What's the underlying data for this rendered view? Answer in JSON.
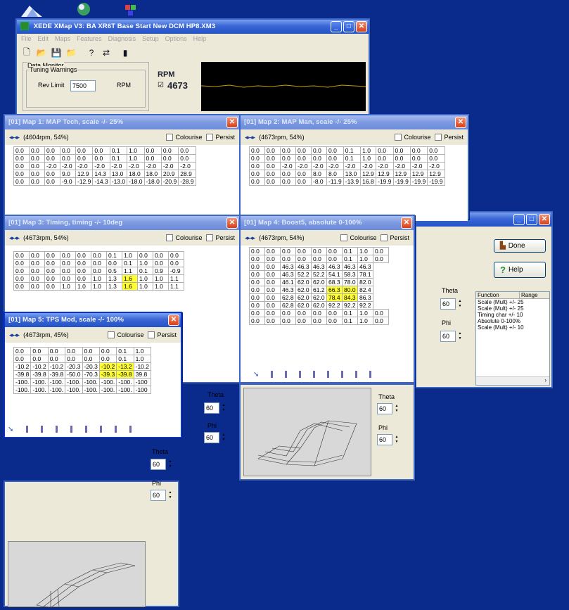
{
  "colors": {
    "desktop": "#0a2a8c",
    "highlight": "#ffff33"
  },
  "main": {
    "title": "XEDE XMap V3: BA XR6T Base Start New DCM HP8.XM3",
    "menu": [
      "File",
      "Edit",
      "Maps",
      "Features",
      "Diagnosis",
      "Setup",
      "Options",
      "Help"
    ],
    "monitor_group": "Data Monitor",
    "tuning_group": "Tuning Warnings",
    "rev_limit_label": "Rev Limit",
    "rev_limit_value": "7500",
    "rev_limit_unit": "RPM",
    "rpm_label": "RPM",
    "rpm_value": "4673"
  },
  "map1": {
    "title": "[01] Map 1: MAP Tech, scale -/- 25%",
    "pos": "(4604rpm, 54%)",
    "colourise": "Colourise",
    "persist": "Persist",
    "rows": [
      [
        "0.0",
        "0.0",
        "0.0",
        "0.0",
        "0.0",
        "0.0",
        "0.1",
        "1.0",
        "0.0",
        "0.0",
        "0.0"
      ],
      [
        "0.0",
        "0.0",
        "0.0",
        "0.0",
        "0.0",
        "0.0",
        "0.1",
        "1.0",
        "0.0",
        "0.0",
        "0.0"
      ],
      [
        "0.0",
        "0.0",
        "-2.0",
        "-2.0",
        "-2.0",
        "-2.0",
        "-2.0",
        "-2.0",
        "-2.0",
        "-2.0",
        "-2.0"
      ],
      [
        "0.0",
        "0.0",
        "0.0",
        "9.0",
        "12.9",
        "14.3",
        "13.0",
        "18.0",
        "18.0",
        "20.9",
        "28.9"
      ],
      [
        "0.0",
        "0.0",
        "0.0",
        "-9.0",
        "-12.9",
        "-14.3",
        "-13.0",
        "-18.0",
        "-18.0",
        "-20.9",
        "-28.9"
      ]
    ]
  },
  "map2": {
    "title": "[01] Map 2: MAP Man, scale -/- 25%",
    "pos": "(4673rpm, 54%)",
    "colourise": "Colourise",
    "persist": "Persist",
    "rows": [
      [
        "0.0",
        "0.0",
        "0.0",
        "0.0",
        "0.0",
        "0.0",
        "0.1",
        "1.0",
        "0.0",
        "0.0",
        "0.0",
        "0.0"
      ],
      [
        "0.0",
        "0.0",
        "0.0",
        "0.0",
        "0.0",
        "0.0",
        "0.1",
        "1.0",
        "0.0",
        "0.0",
        "0.0",
        "0.0"
      ],
      [
        "0.0",
        "0.0",
        "-2.0",
        "-2.0",
        "-2.0",
        "-2.0",
        "-2.0",
        "-2.0",
        "-2.0",
        "-2.0",
        "-2.0",
        "-2.0"
      ],
      [
        "0.0",
        "0.0",
        "0.0",
        "0.0",
        "8.0",
        "8.0",
        "13.0",
        "12.9",
        "12.9",
        "12.9",
        "12.9",
        "12.9"
      ],
      [
        "0.0",
        "0.0",
        "0.0",
        "0.0",
        "-8.0",
        "-11.9",
        "-13.9",
        "16.8",
        "-19.9",
        "-19.9",
        "-19.9",
        "-19.9"
      ]
    ]
  },
  "map3": {
    "title": "[01] Map 3: Timing, timing -/- 10deg",
    "pos": "(4673rpm, 54%)",
    "colourise": "Colourise",
    "persist": "Persist",
    "rows": [
      [
        "0.0",
        "0.0",
        "0.0",
        "0.0",
        "0.0",
        "0.0",
        "0.1",
        "1.0",
        "0.0",
        "0.0",
        "0.0"
      ],
      [
        "0.0",
        "0.0",
        "0.0",
        "0.0",
        "0.0",
        "0.0",
        "0.0",
        "0.1",
        "1.0",
        "0.0",
        "0.0"
      ],
      [
        "0.0",
        "0.0",
        "0.0",
        "0.0",
        "0.0",
        "0.0",
        "0.5",
        "1.1",
        "0.1",
        "0.9",
        "-0.9"
      ],
      [
        "0.0",
        "0.0",
        "0.0",
        "0.0",
        "0.0",
        "1.0",
        "1.3",
        "1.6",
        "1.0",
        "1.0",
        "1.1"
      ],
      [
        "0.0",
        "0.0",
        "0.0",
        "1.0",
        "1.0",
        "1.0",
        "1.3",
        "1.6",
        "1.0",
        "1.0",
        "1.1"
      ]
    ]
  },
  "map4": {
    "title": "[01] Map 4: Boost5, absolute 0-100%",
    "pos": "(4673rpm, 54%)",
    "colourise": "Colourise",
    "persist": "Persist",
    "rows": [
      [
        "0.0",
        "0.0",
        "0.0",
        "0.0",
        "0.0",
        "0.0",
        "0.1",
        "1.0",
        "0.0"
      ],
      [
        "0.0",
        "0.0",
        "0.0",
        "0.0",
        "0.0",
        "0.0",
        "0.1",
        "1.0",
        "0.0"
      ],
      [
        "0.0",
        "0.0",
        "46.3",
        "46.3",
        "46.3",
        "46.3",
        "46.3",
        "46.3"
      ],
      [
        "0.0",
        "0.0",
        "46.3",
        "52.2",
        "52.2",
        "54.1",
        "58.3",
        "78.1"
      ],
      [
        "0.0",
        "0.0",
        "46.1",
        "62.0",
        "62.0",
        "68.3",
        "78.0",
        "82.0"
      ],
      [
        "0.0",
        "0.0",
        "46.3",
        "62.0",
        "61.2",
        "66.3",
        "80.0",
        "82.4"
      ],
      [
        "0.0",
        "0.0",
        "62.8",
        "62.0",
        "62.0",
        "78.4",
        "84.3",
        "86.3"
      ],
      [
        "0.0",
        "0.0",
        "62.8",
        "62.0",
        "62.0",
        "92.2",
        "92.2",
        "92.2"
      ],
      [
        "0.0",
        "0.0",
        "0.0",
        "0.0",
        "0.0",
        "0.0",
        "0.1",
        "1.0",
        "0.0"
      ],
      [
        "0.0",
        "0.0",
        "0.0",
        "0.0",
        "0.0",
        "0.0",
        "0.1",
        "1.0",
        "0.0"
      ]
    ]
  },
  "map5": {
    "title": "[01] Map 5: TPS Mod, scale -/- 100%",
    "pos": "(4673rpm, 45%)",
    "colourise": "Colourise",
    "persist": "Persist",
    "rows": [
      [
        "0.0",
        "0.0",
        "0.0",
        "0.0",
        "0.0",
        "0.0",
        "0.1",
        "1.0"
      ],
      [
        "0.0",
        "0.0",
        "0.0",
        "0.0",
        "0.0",
        "0.0",
        "0.1",
        "1.0"
      ],
      [
        "-10.2",
        "-10.2",
        "-10.2",
        "-20.3",
        "-20.3",
        "-10.2",
        "-13.2",
        "-10.2"
      ],
      [
        "-39.8",
        "-39.8",
        "-39.8",
        "-50.0",
        "-70.3",
        "-39.3",
        "-39.8",
        "39.8"
      ],
      [
        "-100.",
        "-100.",
        "-100.",
        "-100.",
        "-100.",
        "-100.",
        "-100.",
        "-100"
      ],
      [
        "-100.",
        "-100.",
        "-100.",
        "-100.",
        "-100.",
        "-100.",
        "-100.",
        "-100"
      ]
    ]
  },
  "side": {
    "done": "Done",
    "help": "Help",
    "theta_label": "Theta",
    "theta_value": "60",
    "phi_label": "Phi",
    "phi_value": "60",
    "col_function": "Function",
    "col_range": "Range",
    "list": [
      "Scale (Mult) +/- 25",
      "Scale (Mult) +/- 25",
      "Timing char +/- 10",
      "Absolute 0-100%",
      "Scale (Mult) +/- 10"
    ]
  },
  "plot": {
    "theta_label": "Theta",
    "theta_value": "60",
    "phi_label": "Phi",
    "phi_value": "60"
  }
}
